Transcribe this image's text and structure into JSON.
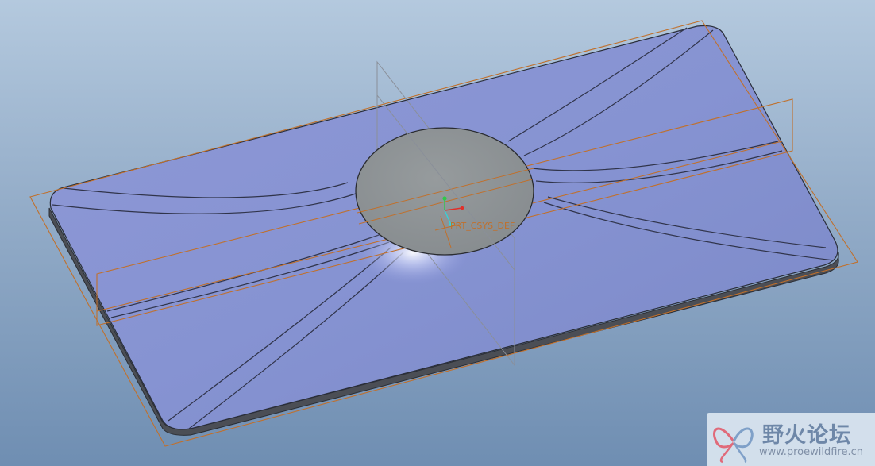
{
  "viewport": {
    "csys_label": "PRT_CSYS_DEF"
  },
  "watermark": {
    "title": "野火论坛",
    "url": "www.proewildfire.cn",
    "logo_icon": "butterfly-logo-icon"
  },
  "colors": {
    "background_top": "#b4c9de",
    "background_bottom": "#6f8eb2",
    "plate_face": "#8a96d4",
    "plate_edge": "#4a4d54",
    "boss_face": "#8f9496",
    "datum_plane": "#c0702c",
    "csys_x": "#e0302a",
    "csys_y": "#2fc84a",
    "csys_z": "#37d0d8"
  }
}
